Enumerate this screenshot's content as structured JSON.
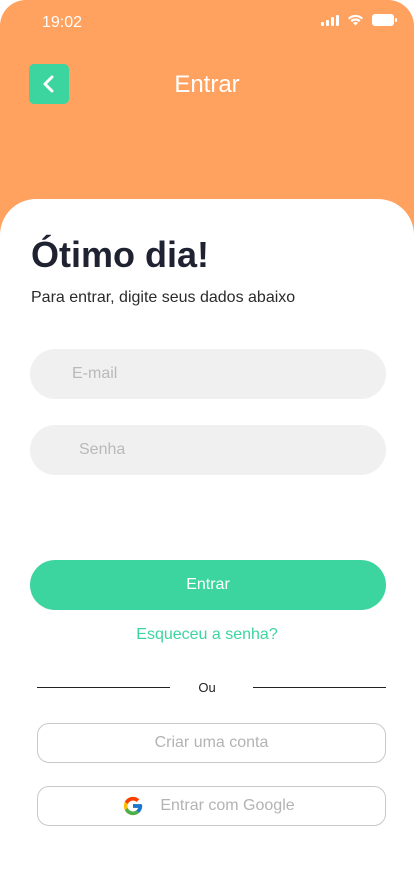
{
  "status_bar": {
    "time": "19:02"
  },
  "header": {
    "title": "Entrar",
    "back_icon": "chevron-left-icon",
    "background_color": "#FFA15F"
  },
  "greeting": {
    "title": "Ótimo dia!",
    "subtitle": "Para entrar, digite seus dados abaixo"
  },
  "form": {
    "email_placeholder": "E-mail",
    "password_placeholder": "Senha",
    "submit_label": "Entrar",
    "forgot_label": "Esqueceu a senha?"
  },
  "divider": {
    "label": "Ou"
  },
  "alternatives": {
    "create_account_label": "Criar uma conta",
    "google_label": "Entrar com Google",
    "google_icon": "google-icon"
  },
  "colors": {
    "accent": "#3DD59F",
    "header": "#FFA15F",
    "input_bg": "#F0F0F0"
  }
}
